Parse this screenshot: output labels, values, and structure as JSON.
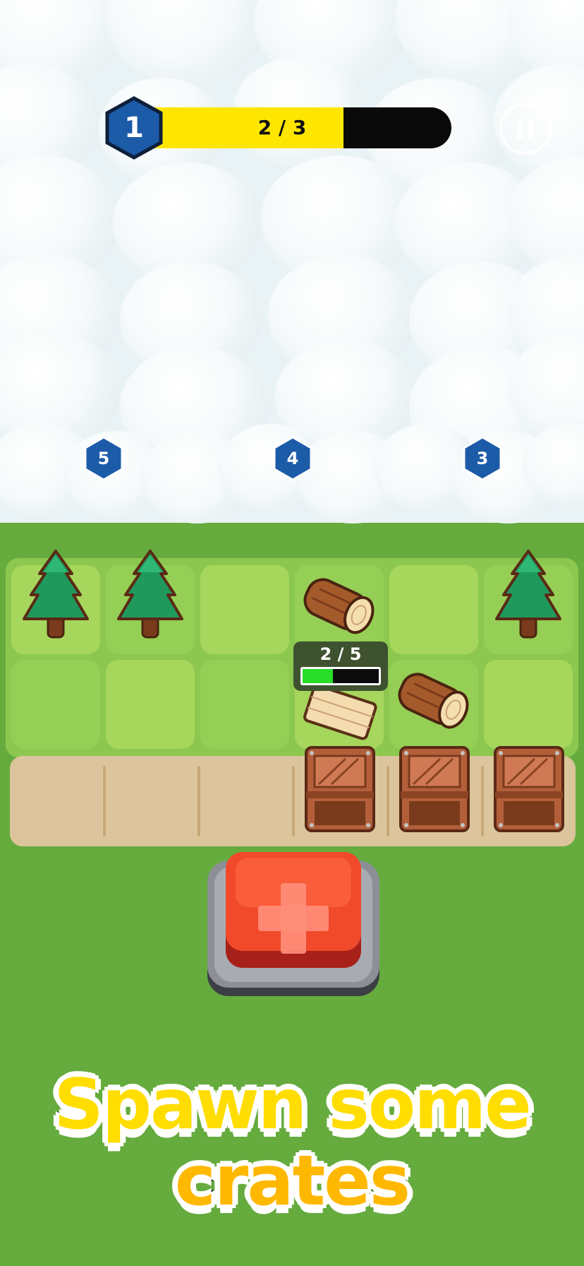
{
  "hud": {
    "level_number": "1",
    "progress_text": "2 / 3",
    "progress_fraction": 0.667,
    "pause_icon": "pause-icon"
  },
  "locked_zones": [
    {
      "label": "5"
    },
    {
      "label": "4"
    },
    {
      "label": "3"
    }
  ],
  "board": {
    "rows": [
      [
        "tree",
        "tree",
        "empty",
        "log",
        "empty",
        "tree"
      ],
      [
        "empty",
        "empty",
        "empty",
        "planks",
        "log",
        "empty"
      ]
    ],
    "conveyor": [
      "empty",
      "empty",
      "empty",
      "crate",
      "crate",
      "crate"
    ]
  },
  "production": {
    "text": "2 / 5",
    "fraction": 0.4
  },
  "spawn_button": {
    "icon": "plus-icon"
  },
  "caption": {
    "line1": "Spawn some",
    "line2": "crates"
  },
  "colors": {
    "grass": "#66ab3e",
    "tile_light": "#a7d65c",
    "tile_dark": "#96cf55",
    "progress_yellow": "#ffe600",
    "badge_blue": "#1c5ba8",
    "button_red": "#f04a2a",
    "caption_yellow": "#ffdd00"
  }
}
